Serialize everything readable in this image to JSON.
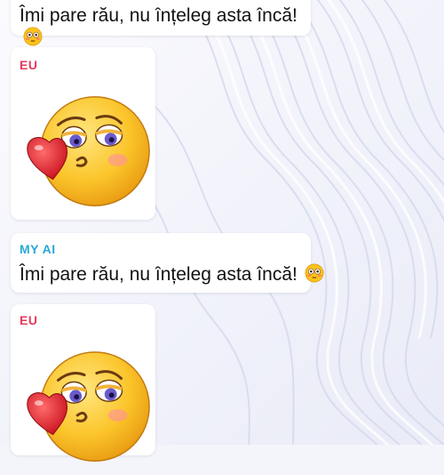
{
  "messages": [
    {
      "sender": "",
      "type": "text",
      "text": "Îmi pare rău, nu înțeleg asta încă!",
      "emoji": "flushed-face"
    },
    {
      "sender": "EU",
      "type": "sticker",
      "sticker": "kissing-face-with-heart"
    },
    {
      "sender": "MY AI",
      "type": "text",
      "text": "Îmi pare rău, nu înțeleg asta încă!",
      "emoji": "flushed-face"
    },
    {
      "sender": "EU",
      "type": "sticker",
      "sticker": "kissing-face-with-heart"
    }
  ],
  "colors": {
    "me_label": "#e63a5c",
    "ai_label": "#2aa8d8",
    "background": "#f4f5fb",
    "bubble": "#ffffff"
  }
}
